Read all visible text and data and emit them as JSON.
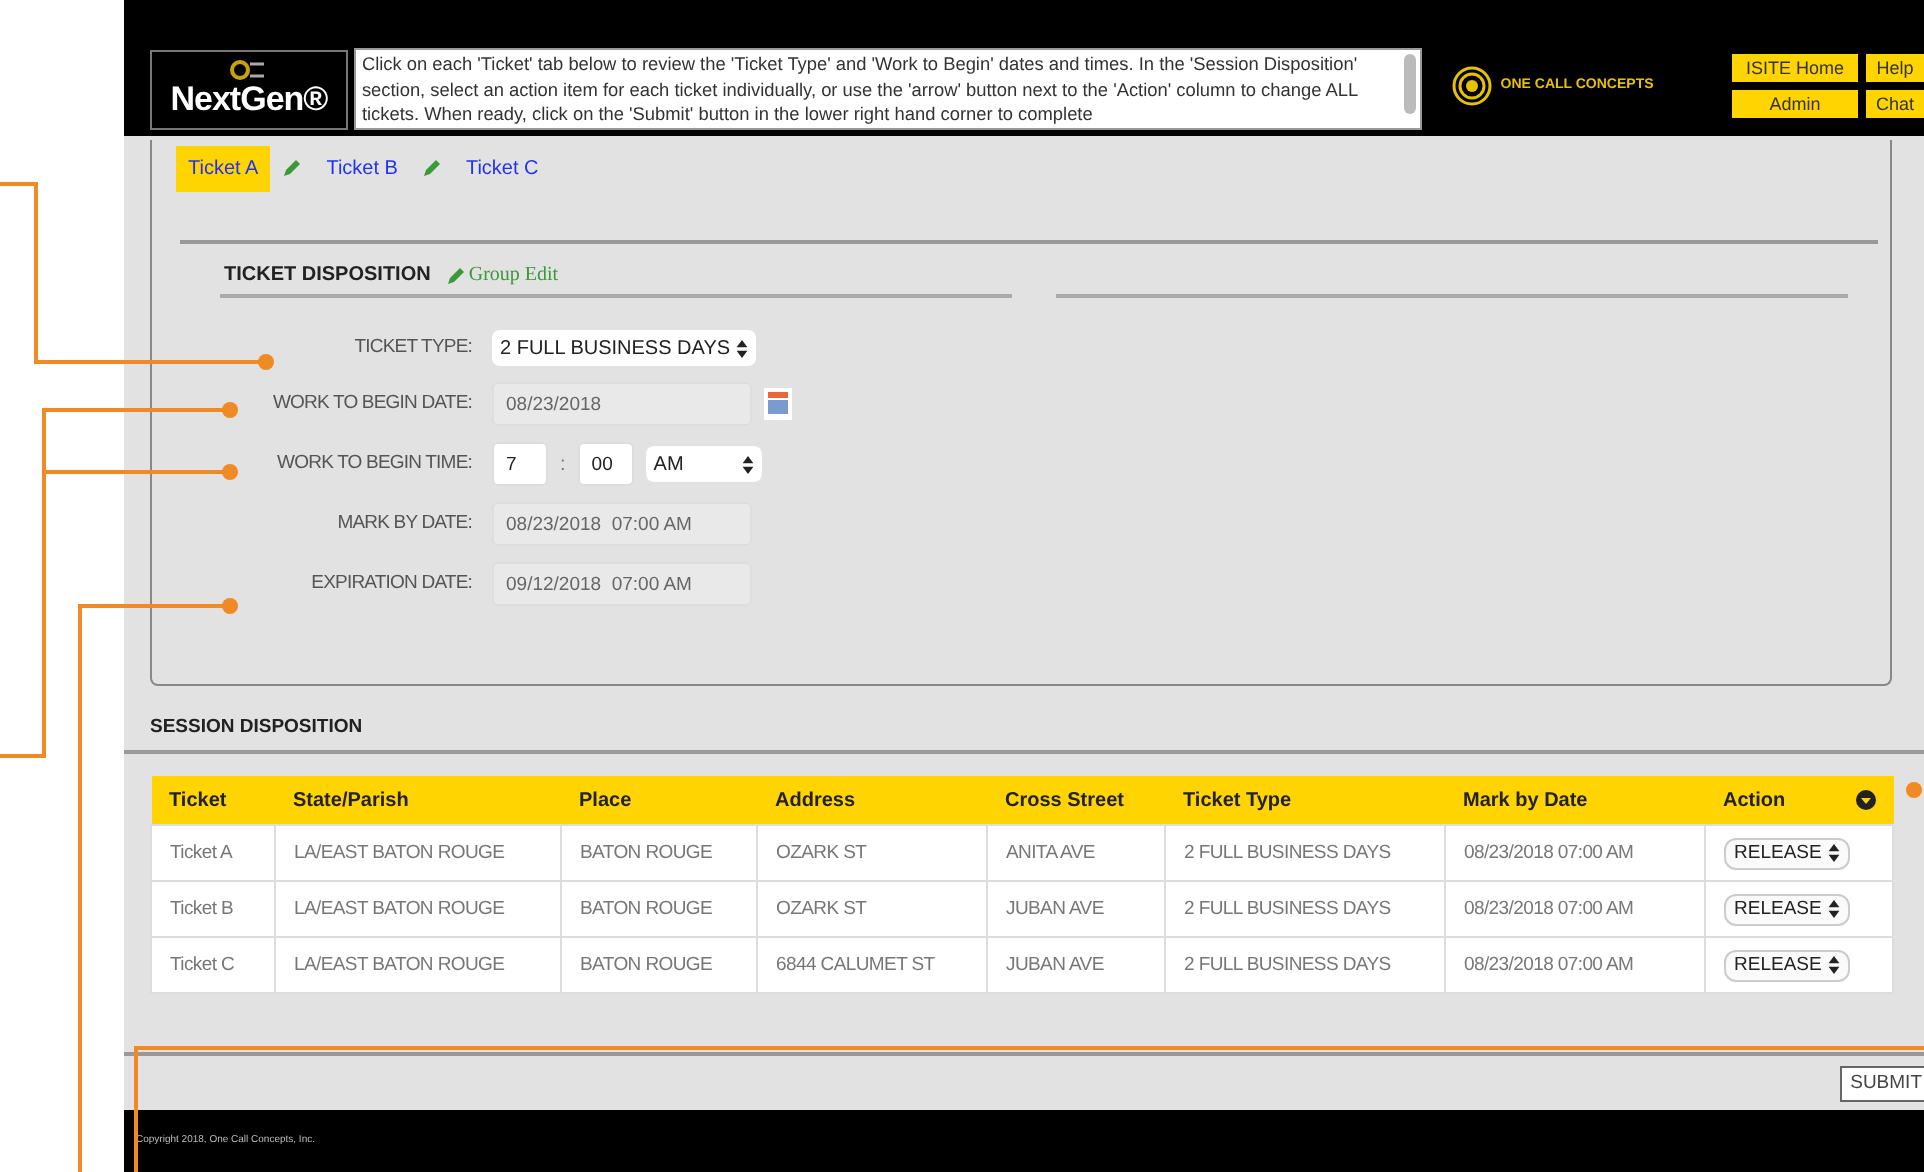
{
  "header": {
    "logo": "NextGen®",
    "instructions": "Click on each 'Ticket' tab below to review the 'Ticket Type' and 'Work to Begin' dates and times. In the 'Session Disposition' section, select an action item for each ticket individually, or use the 'arrow' button next to the 'Action' column to change ALL tickets. When ready, click on the 'Submit' button in the lower right hand corner to complete",
    "brand": "ONE CALL CONCEPTS",
    "buttons": [
      {
        "label": "ISITE Home"
      },
      {
        "label": "Help"
      },
      {
        "label": "Admin"
      },
      {
        "label": "Chat"
      }
    ]
  },
  "tabs": [
    {
      "label": "Ticket A",
      "selected": true
    },
    {
      "label": "Ticket B",
      "selected": false
    },
    {
      "label": "Ticket C",
      "selected": false
    }
  ],
  "ticket_disposition": {
    "title": "TICKET DISPOSITION",
    "group_edit": "Group Edit",
    "fields": [
      {
        "kind": "select",
        "label": "TICKET TYPE:",
        "value": "2 FULL BUSINESS DAYS",
        "disabled": false
      },
      {
        "kind": "date",
        "label": "WORK TO BEGIN DATE:",
        "value": "08/23/2018",
        "disabled": true
      },
      {
        "kind": "time",
        "label": "WORK TO BEGIN TIME:",
        "hour": "7",
        "separator": ":",
        "minute": "00",
        "period": "AM",
        "disabled": false
      },
      {
        "kind": "text",
        "label": "MARK BY DATE:",
        "value": "08/23/2018  07:00 AM",
        "disabled": true
      },
      {
        "kind": "text",
        "label": "EXPIRATION DATE:",
        "value": "09/12/2018  07:00 AM",
        "disabled": true
      }
    ]
  },
  "session_disposition": {
    "title": "SESSION DISPOSITION",
    "columns": [
      "Ticket",
      "State/Parish",
      "Place",
      "Address",
      "Cross Street",
      "Ticket Type",
      "Mark by Date",
      "Action"
    ],
    "rows": [
      {
        "cells": [
          "Ticket A",
          "LA/EAST BATON ROUGE",
          "BATON ROUGE",
          "OZARK ST",
          "ANITA AVE",
          "2 FULL BUSINESS DAYS",
          "08/23/2018 07:00 AM"
        ],
        "action": "RELEASE"
      },
      {
        "cells": [
          "Ticket B",
          "LA/EAST BATON ROUGE",
          "BATON ROUGE",
          "OZARK ST",
          "JUBAN AVE",
          "2 FULL BUSINESS DAYS",
          "08/23/2018 07:00 AM"
        ],
        "action": "RELEASE"
      },
      {
        "cells": [
          "Ticket C",
          "LA/EAST BATON ROUGE",
          "BATON ROUGE",
          "6844 CALUMET ST",
          "JUBAN AVE",
          "2 FULL BUSINESS DAYS",
          "08/23/2018 07:00 AM"
        ],
        "action": "RELEASE"
      }
    ]
  },
  "submit": "SUBMIT",
  "footer": {
    "copyright": "Copyright 2018, One Call Concepts, Inc."
  }
}
